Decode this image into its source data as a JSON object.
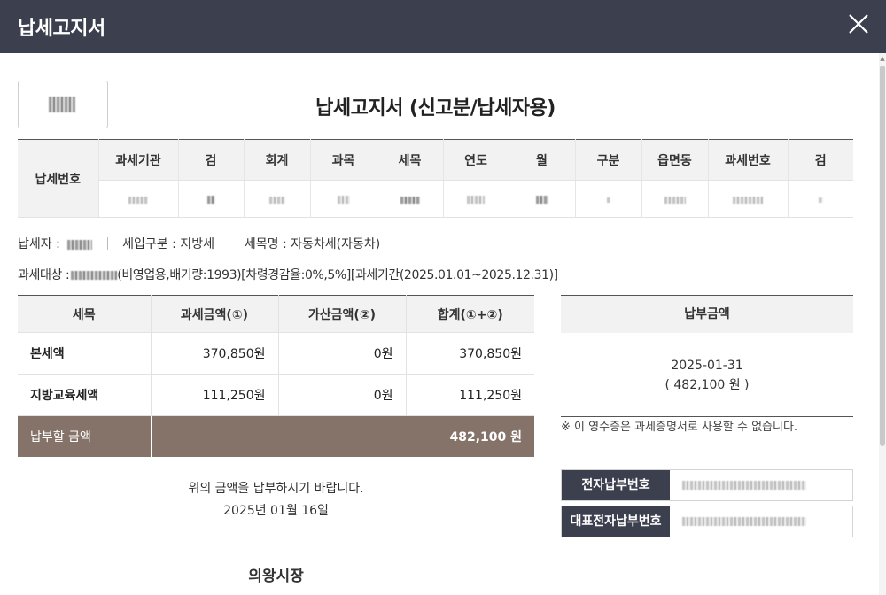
{
  "window": {
    "title": "납세고지서",
    "close_icon": "close-icon"
  },
  "document": {
    "title": "납세고지서 (신고분/납세자용)"
  },
  "tax_number": {
    "row_label": "납세번호",
    "columns": [
      "과세기관",
      "검",
      "회계",
      "과목",
      "세목",
      "연도",
      "월",
      "구분",
      "읍면동",
      "과세번호",
      "검"
    ]
  },
  "taxpayer": {
    "name_label": "납세자 :",
    "revenue_type": "세입구분 : 지방세",
    "tax_item": "세목명 : 자동차세(자동차)"
  },
  "tax_target": {
    "prefix": "과세대상 :",
    "detail": "(비영업용,배기량:1993)[차령경감율:0%,5%][과세기간(2025.01.01~2025.12.31)]"
  },
  "amount_table": {
    "headers": [
      "세목",
      "과세금액(①)",
      "가산금액(②)",
      "합계(①+②)"
    ],
    "rows": [
      {
        "item": "본세액",
        "taxable": "370,850원",
        "additional": "0원",
        "total": "370,850원"
      },
      {
        "item": "지방교육세액",
        "taxable": "111,250원",
        "additional": "0원",
        "total": "111,250원"
      }
    ],
    "total_label": "납부할 금액",
    "total_value": "482,100 원"
  },
  "notice": {
    "request": "위의 금액을 납부하시기 바랍니다.",
    "date": "2025년 01월 16일"
  },
  "issuer": "의왕시장",
  "payment": {
    "header": "납부금액",
    "due_date": "2025-01-31",
    "amount": "( 482,100 원 )",
    "receipt_note": "※ 이 영수증은 과세증명서로 사용할 수 없습니다."
  },
  "electronic_payment": {
    "number_label": "전자납부번호",
    "representative_label": "대표전자납부번호"
  },
  "colors": {
    "header_bg": "#3b3f4e",
    "total_row_bg": "#857369"
  }
}
